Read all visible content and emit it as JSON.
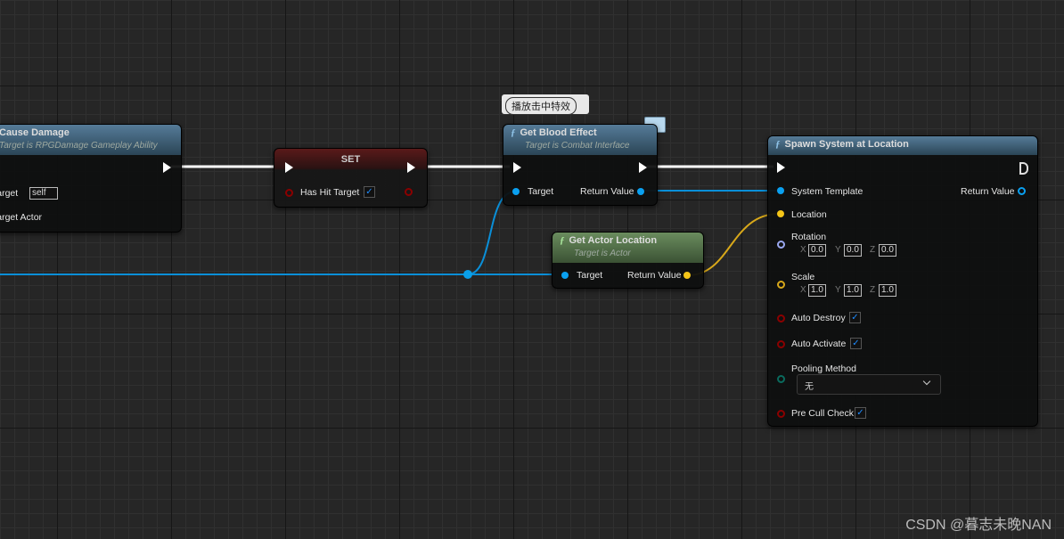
{
  "nodes": {
    "cause_damage": {
      "title": "Cause Damage",
      "subtitle": "Target is RPGDamage Gameplay Ability",
      "pins": {
        "target": "Target",
        "target_value": "self",
        "target_actor": "Target Actor"
      }
    },
    "set": {
      "title": "SET",
      "pins": {
        "has_hit_target": "Has Hit Target",
        "checked": true
      }
    },
    "get_blood_effect": {
      "title": "Get Blood Effect",
      "subtitle": "Target is Combat Interface",
      "comment": "播放击中特效",
      "pins": {
        "target": "Target",
        "return_value": "Return Value"
      }
    },
    "get_actor_location": {
      "title": "Get Actor Location",
      "subtitle": "Target is Actor",
      "pins": {
        "target": "Target",
        "return_value": "Return Value"
      }
    },
    "spawn_system": {
      "title": "Spawn System at Location",
      "pins": {
        "system_template": "System Template",
        "return_value": "Return Value",
        "location": "Location",
        "rotation": "Rotation",
        "rotation_values": {
          "x": "0.0",
          "y": "0.0",
          "z": "0.0"
        },
        "scale": "Scale",
        "scale_values": {
          "x": "1.0",
          "y": "1.0",
          "z": "1.0"
        },
        "auto_destroy": "Auto Destroy",
        "auto_activate": "Auto Activate",
        "pooling_method": "Pooling Method",
        "pooling_value": "无",
        "pre_cull_check": "Pre Cull Check"
      },
      "axes": {
        "x": "X",
        "y": "Y",
        "z": "Z"
      }
    }
  },
  "colors": {
    "exec": "#ffffff",
    "object": "#0aa0f0",
    "vector": "#f5c518",
    "rotator": "#9aa8f0",
    "bool": "#8b0000",
    "enum": "#0a6b5e"
  },
  "icons": {
    "function": "ƒ",
    "checkmark": "✓"
  },
  "watermark": "CSDN @暮志未晚NAN"
}
